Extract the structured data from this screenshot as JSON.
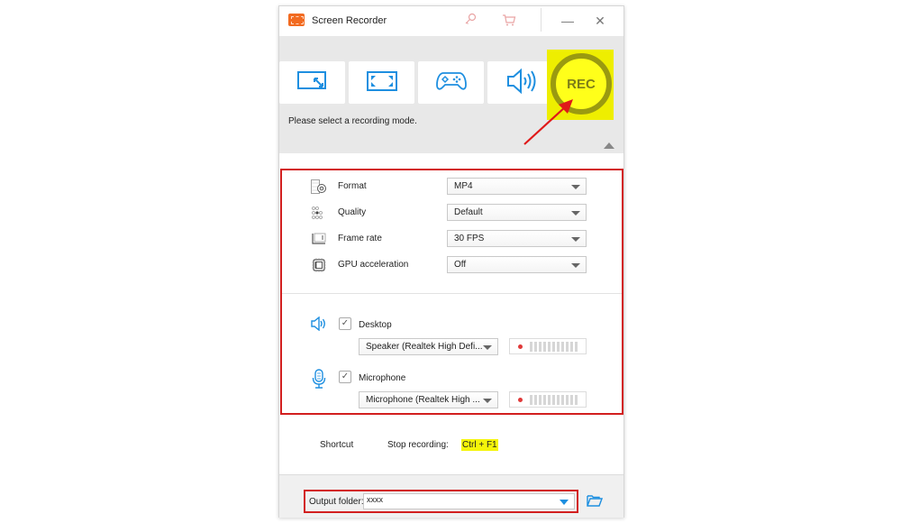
{
  "titlebar": {
    "title": "Screen Recorder",
    "icons": [
      "key-icon",
      "cart-icon"
    ],
    "minimize": "—",
    "close": "✕"
  },
  "modes": {
    "buttons": [
      {
        "name": "region-capture",
        "icon": "region-resize-icon"
      },
      {
        "name": "fullscreen-capture",
        "icon": "fullscreen-icon"
      },
      {
        "name": "game-capture",
        "icon": "gamepad-icon"
      },
      {
        "name": "audio-only",
        "icon": "speaker-icon"
      }
    ],
    "rec_label": "REC",
    "hint": "Please select a recording mode."
  },
  "settings": {
    "rows": [
      {
        "label": "Format",
        "value": "MP4",
        "icon": "format-gear-icon"
      },
      {
        "label": "Quality",
        "value": "Default",
        "icon": "quality-dots-icon"
      },
      {
        "label": "Frame rate",
        "value": "30 FPS",
        "icon": "frame-rate-icon"
      },
      {
        "label": "GPU acceleration",
        "value": "Off",
        "icon": "gpu-chip-icon"
      }
    ]
  },
  "audio": {
    "desktop": {
      "label": "Desktop",
      "checked": true,
      "device": "Speaker (Realtek High Defi...",
      "level": 0
    },
    "microphone": {
      "label": "Microphone",
      "checked": true,
      "device": "Microphone (Realtek High ...",
      "level": 0
    }
  },
  "shortcut": {
    "label": "Shortcut",
    "action": "Stop recording:",
    "keys": "Ctrl + F1"
  },
  "output": {
    "label": "Output folder:",
    "value": "xxxx"
  },
  "colors": {
    "accent": "#1e8fe0",
    "highlight": "#d21f1f",
    "rec_yellow": "#ffff1a"
  }
}
